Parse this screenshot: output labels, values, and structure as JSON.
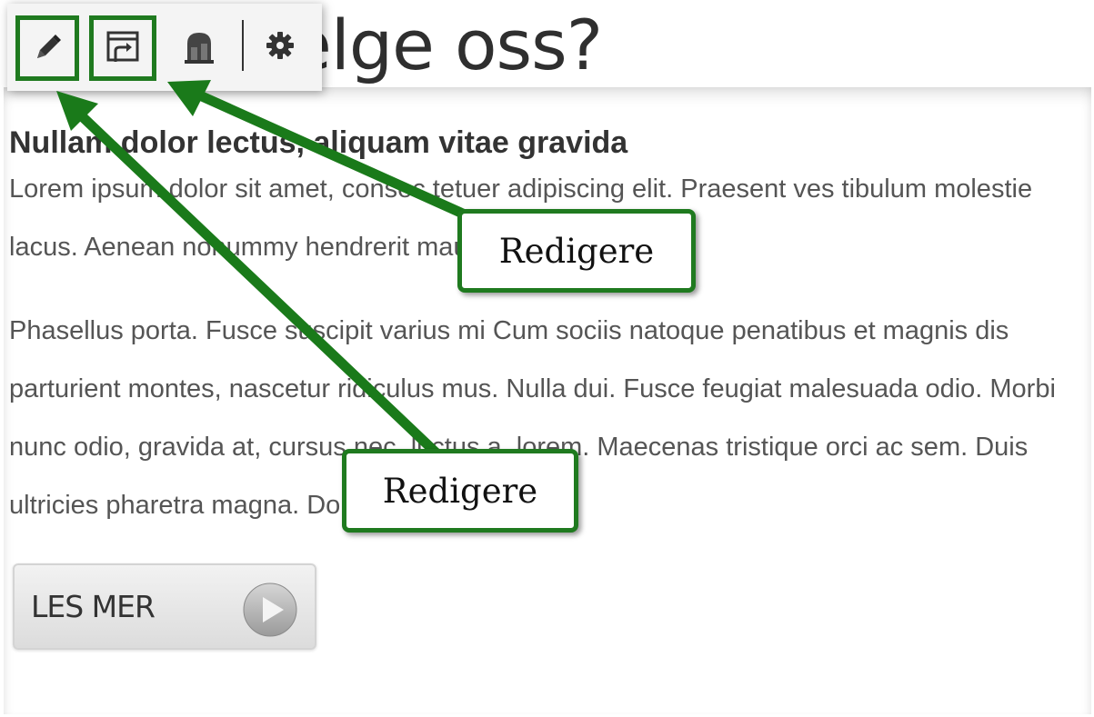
{
  "page": {
    "heading": "Hvorfor velge oss?",
    "heading_visible": "elge oss?"
  },
  "toolbar": {
    "buttons": [
      {
        "icon": "pencil-icon",
        "label": "Edit"
      },
      {
        "icon": "source-edit-icon",
        "label": "Edit source"
      },
      {
        "icon": "stack-icon",
        "label": "Stack"
      },
      {
        "icon": "gear-icon",
        "label": "Settings"
      }
    ]
  },
  "content": {
    "subtitle": "Nullam dolor lectus, aliquam vitae gravida",
    "paragraph1": "Lorem ipsum dolor sit amet, consec tetuer adipiscing elit. Praesent ves tibulum molestie lacus. Aenean nonummy hendrerit mauris.",
    "paragraph2": "Phasellus porta. Fusce suscipit varius mi Cum sociis natoque penatibus et magnis dis parturient montes, nascetur ridiculus mus. Nulla dui. Fusce feugiat malesuada odio. Morbi nunc odio, gravida at, cursus nec, luctus a, lorem. Maecenas tristique orci ac sem. Duis ultricies pharetra magna. Donec accum.",
    "read_more_label": "LES MER"
  },
  "annotations": {
    "callout_top": "Redigere",
    "callout_bottom": "Redigere",
    "accent_color": "#1f7a1f"
  }
}
